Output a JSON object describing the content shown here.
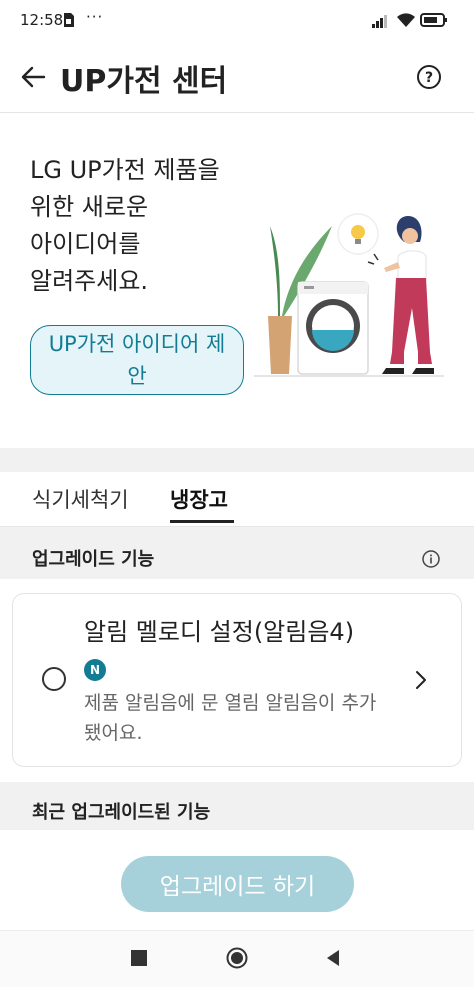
{
  "status_bar": {
    "time": "12:58",
    "dots": "···"
  },
  "header": {
    "title": "UP가전 센터"
  },
  "hero": {
    "line1": "LG UP가전 제품을",
    "line2": "위한 새로운",
    "line3": "아이디어를",
    "line4": "알려주세요.",
    "button_label": "UP가전 아이디어 제안"
  },
  "tabs": [
    {
      "label": "식기세척기",
      "selected": false
    },
    {
      "label": "냉장고",
      "selected": true
    }
  ],
  "upgrade_section": {
    "title": "업그레이드 기능",
    "item": {
      "title": "알림 멜로디 설정(알림음4)",
      "badge": "N",
      "description": "제품 알림음에 문 열림 알림음이 추가됐어요."
    }
  },
  "recent_section": {
    "title": "최근 업그레이드된 기능"
  },
  "upgrade_button": {
    "label": "업그레이드 하기"
  },
  "colors": {
    "accent": "#117c94",
    "button_disabled": "#a7d1da",
    "section_bg": "#f1f1f1"
  }
}
